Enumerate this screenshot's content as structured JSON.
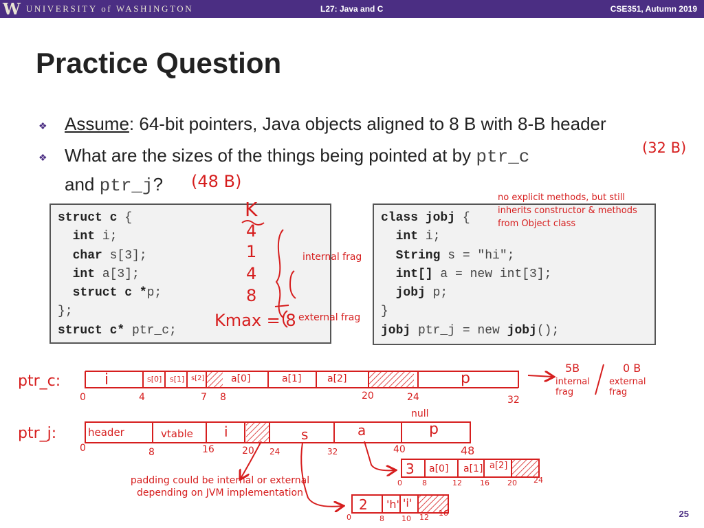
{
  "header": {
    "brand_letter": "W",
    "university": "UNIVERSITY of WASHINGTON",
    "lecture": "L27:  Java and C",
    "course": "CSE351, Autumn 2019"
  },
  "slide": {
    "title": "Practice Question",
    "bullet1_label": "Assume",
    "bullet1_text": ":  64-bit pointers, Java objects aligned to 8 B with 8-B header",
    "bullet2_text": "What are the sizes of the things being pointed at by",
    "bullet2_code1": "ptr_c",
    "bullet2_and": "and",
    "bullet2_code2": "ptr_j",
    "bullet2_q": "?",
    "number": "25"
  },
  "code": {
    "c_lines": [
      [
        [
          "struct c",
          "k"
        ],
        [
          " {",
          ""
        ]
      ],
      [
        [
          "  int",
          "k"
        ],
        [
          " i;",
          ""
        ]
      ],
      [
        [
          "  char",
          "k"
        ],
        [
          " s[3];",
          ""
        ]
      ],
      [
        [
          "  int",
          "k"
        ],
        [
          " a[3];",
          ""
        ]
      ],
      [
        [
          "  struct c *",
          "k"
        ],
        [
          "p;",
          ""
        ]
      ],
      [
        [
          "};",
          ""
        ]
      ],
      [
        [
          "struct c*",
          "k"
        ],
        [
          " ptr_c;",
          ""
        ]
      ]
    ],
    "java_lines": [
      [
        [
          "class jobj",
          "k"
        ],
        [
          " {",
          ""
        ]
      ],
      [
        [
          "  int",
          "k"
        ],
        [
          " i;",
          ""
        ]
      ],
      [
        [
          "  String",
          "k"
        ],
        [
          " s = \"hi\";",
          ""
        ]
      ],
      [
        [
          "  int[]",
          "k"
        ],
        [
          " a = new int[3];",
          ""
        ]
      ],
      [
        [
          "  jobj",
          "k"
        ],
        [
          " p;",
          ""
        ]
      ],
      [
        [
          "}",
          ""
        ]
      ],
      [
        [
          "jobj",
          "k"
        ],
        [
          " ptr_j = new ",
          ""
        ],
        [
          "jobj",
          "k"
        ],
        [
          "();",
          ""
        ]
      ]
    ]
  },
  "annotations": {
    "ptr_c_size": "(32 B)",
    "ptr_j_size": "(48 B)",
    "K": "K",
    "k_values": [
      "4",
      "1",
      "4",
      "8"
    ],
    "kmax": "Kmax = 8",
    "internal_frag": "internal frag",
    "external_frag": "external frag",
    "java_note": "no explicit methods, but still inherits constructor & methods from Object class",
    "frag_5b": "5B",
    "frag_0b": "0 B",
    "frag_internal": "internal frag",
    "frag_external": "external frag",
    "null": "null",
    "padding_note": "padding could be internal or external depending on JVM implementation"
  },
  "ptr_c_diagram": {
    "label": "ptr_c:",
    "cells": [
      "i",
      "s[0]",
      "s[1]",
      "s[2]",
      "a[0]",
      "a[1]",
      "a[2]",
      "p"
    ],
    "offsets": [
      "0",
      "4",
      "7",
      "8",
      "20",
      "24",
      "32"
    ]
  },
  "ptr_j_diagram": {
    "label": "ptr_j:",
    "cells": [
      "header",
      "vtable",
      "i",
      "s",
      "a",
      "p"
    ],
    "offsets": [
      "0",
      "8",
      "16",
      "20",
      "24",
      "32",
      "40",
      "48"
    ]
  },
  "array_diagram": {
    "cells": [
      "3",
      "a[0]",
      "a[1]",
      "a[2]"
    ],
    "offsets": [
      "0",
      "8",
      "12",
      "16",
      "20",
      "24"
    ]
  },
  "string_diagram": {
    "cells": [
      "2",
      "'h'",
      "'i'"
    ],
    "offsets": [
      "0",
      "8",
      "10",
      "12",
      "16"
    ]
  },
  "colors": {
    "header_bg": "#4b2e83",
    "ink_red": "#d61e1e",
    "code_bg": "#f2f2f2"
  }
}
